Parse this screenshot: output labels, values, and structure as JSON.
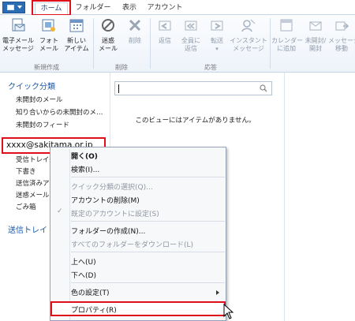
{
  "tabs": {
    "file_icon": "outlook-file-icon",
    "home": "ホーム",
    "folder": "フォルダー",
    "view": "表示",
    "account": "アカウント"
  },
  "ribbon": {
    "new_email": "電子メール\nメッセージ",
    "new_photo": "フォト\nメール",
    "new_items": "新しい\nアイテム",
    "spam": "迷惑\nメール",
    "delete": "削除",
    "reply": "返信",
    "reply_all": "全員に\n返信",
    "forward": "転送",
    "im": "インスタント\nメッセージ",
    "calendar": "カレンダー\nに追加",
    "unread": "未開封/\n開封",
    "move": "メッセージ\n移動",
    "group_new": "新規作成",
    "group_delete": "削除",
    "group_respond": "応答"
  },
  "nav": {
    "quick_views": "クイック分類",
    "unread_mail": "未開封のメール",
    "unread_contacts": "知り合いからの未開封のメ…",
    "unread_feeds": "未開封のフィード",
    "account": "xxxx@sakitama.or.jp",
    "inbox": "受信トレイ",
    "drafts": "下書き",
    "sent": "送信済みア",
    "junk": "迷惑メール",
    "trash": "ごみ箱",
    "outbox": "送信トレイ"
  },
  "search": {
    "placeholder": ""
  },
  "list": {
    "empty_message": "このビューにはアイテムがありません。"
  },
  "context_menu": {
    "open": "開く(O)",
    "find": "検索(I)...",
    "quick_views": "クイック分類の選択(Q)...",
    "delete_account": "アカウントの削除(M)",
    "set_default": "既定のアカウントに設定(S)",
    "create_folder": "フォルダーの作成(N)...",
    "download_all": "すべてのフォルダーをダウンロード(L)",
    "move_up": "上へ(U)",
    "move_down": "下へ(D)",
    "set_color": "色の設定(T)",
    "properties": "プロパティ(R)"
  },
  "colors": {
    "accent": "#2b6cb3",
    "highlight": "#e0101a",
    "nav_heading": "#1e5aa8"
  }
}
